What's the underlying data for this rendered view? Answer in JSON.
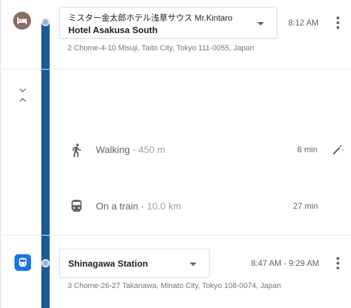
{
  "colors": {
    "route_line": "#1a5a9c",
    "hotel_icon_bg": "#8c6e63",
    "station_icon_bg": "#1a73e8",
    "muted_text": "#5f6368",
    "light_text": "#9aa0a6"
  },
  "origin": {
    "icon": "hotel-bed-icon",
    "name_line1": "ミスター金太郎ホテル浅草サウス Mr.Kintaro",
    "name_line2": "Hotel Asakusa South",
    "time": "8:12 AM",
    "address": "2 Chome-4-10 Misuji, Taito City, Tokyo 111-0055, Japan"
  },
  "steps": [
    {
      "icon": "walking-person-icon",
      "mode": "Walking",
      "separator": " - ",
      "distance": "450 m",
      "duration": "8 min",
      "tool_icon": "magic-wand-icon"
    },
    {
      "icon": "train-icon",
      "mode": "On a train",
      "separator": " - ",
      "distance": "10.0 km",
      "duration": "27 min"
    }
  ],
  "destination": {
    "icon": "train-station-icon",
    "name": "Shinagawa Station",
    "time": "8:47 AM - 9:29 AM",
    "address": "3 Chome-26-27 Takanawa, Minato City, Tokyo 108-0074, Japan"
  }
}
